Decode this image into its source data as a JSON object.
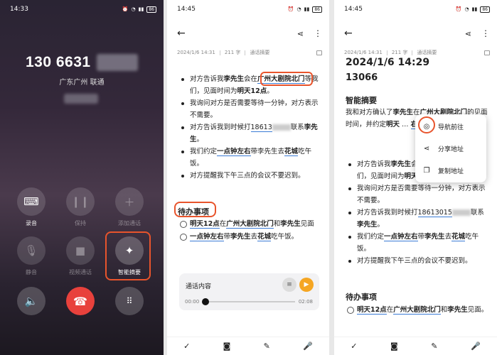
{
  "call": {
    "time": "14:33",
    "battery": "86",
    "number": "130 6631",
    "location": "广东广州 联通",
    "buttons": [
      {
        "label": "录音"
      },
      {
        "label": "保持"
      },
      {
        "label": "添加通话"
      },
      {
        "label": "静音"
      },
      {
        "label": "视频通话"
      },
      {
        "label": "智能摘要"
      }
    ],
    "colors": {
      "accent": "#e8542c",
      "hangup": "#e8413c"
    }
  },
  "note": {
    "time": "14:45",
    "battery": "86",
    "meta_date": "2024/1/6 14:31",
    "meta_words": "211 字",
    "meta_type": "通话摘要",
    "bullets": [
      {
        "parts": [
          {
            "t": "对方告诉我"
          },
          {
            "t": "李先生",
            "b": 1
          },
          {
            "t": "会在"
          },
          {
            "t": "广州大剧院北门",
            "b": 1,
            "u": 1
          },
          {
            "t": "等我们，见面时间为"
          },
          {
            "t": "明天12点",
            "b": 1
          },
          {
            "t": "。"
          }
        ]
      },
      {
        "parts": [
          {
            "t": "我询问对方是否需要等待一分钟，对方表示不需要。"
          }
        ]
      },
      {
        "parts": [
          {
            "t": "对方告诉我到时候打"
          },
          {
            "t": "18613",
            "u": 1
          },
          {
            "blur": 1
          },
          {
            "t": "联系"
          },
          {
            "t": "李先生",
            "b": 1
          },
          {
            "t": "。"
          }
        ]
      },
      {
        "parts": [
          {
            "t": "我们约定"
          },
          {
            "t": "一点钟左右",
            "b": 1,
            "u": 1
          },
          {
            "t": "带李先生去"
          },
          {
            "t": "花城",
            "b": 1,
            "u": 1
          },
          {
            "t": "吃午饭。"
          }
        ]
      },
      {
        "parts": [
          {
            "t": "对方提醒我下午三点的会议不要迟到。"
          }
        ]
      }
    ],
    "todo_title": "待办事项",
    "todos": [
      {
        "parts": [
          {
            "t": "明天12点",
            "b": 1,
            "u": 1
          },
          {
            "t": "在"
          },
          {
            "t": "广州大剧院北门",
            "b": 1,
            "u": 1
          },
          {
            "t": "和"
          },
          {
            "t": "李先生",
            "b": 1
          },
          {
            "t": "见面"
          }
        ]
      },
      {
        "parts": [
          {
            "t": "一点钟左右",
            "b": 1,
            "u": 1
          },
          {
            "t": "带"
          },
          {
            "t": "李先生",
            "b": 1
          },
          {
            "t": "去"
          },
          {
            "t": "花城",
            "b": 1,
            "u": 1
          },
          {
            "t": "吃午饭。"
          }
        ]
      }
    ],
    "audio_title": "通话内容",
    "audio_start": "00:00",
    "audio_end": "02:08"
  },
  "detail": {
    "time": "14:45",
    "battery": "86",
    "meta_date": "2024/1/6 14:31",
    "meta_words": "211 字",
    "meta_type": "通话摘要",
    "title": "2024/1/6 14:29",
    "phone": "13066",
    "summary_title": "智能摘要",
    "summary_parts": [
      {
        "t": "我和对方确认了"
      },
      {
        "t": "李先生",
        "b": 1
      },
      {
        "t": "在"
      },
      {
        "t": "广州大剧院北门",
        "b": 1,
        "u": 1
      },
      {
        "t": "的见面时间，并约定"
      },
      {
        "t": "明天",
        "b": 1
      },
      {
        "t": " … "
      },
      {
        "t": "右",
        "b": 1,
        "u": 1
      },
      {
        "t": "带他去"
      },
      {
        "t": "花城",
        "b": 1,
        "u": 1
      },
      {
        "t": "吃午饭。"
      }
    ],
    "bullets": [
      {
        "parts": [
          {
            "t": "对方告诉我"
          },
          {
            "t": "李先生",
            "b": 1
          },
          {
            "t": "会在"
          },
          {
            "t": "广州大剧院北门",
            "b": 1,
            "u": 1
          },
          {
            "t": "等我们，见面时间为"
          },
          {
            "t": "明天12点",
            "b": 1
          },
          {
            "t": "。"
          }
        ]
      },
      {
        "parts": [
          {
            "t": "我询问对方是否需要等待一分钟，对方表示不需要。"
          }
        ]
      },
      {
        "parts": [
          {
            "t": "对方告诉我到时候打"
          },
          {
            "t": "18613015",
            "u": 1
          },
          {
            "blur": 1
          },
          {
            "t": "联系"
          },
          {
            "t": "李先生",
            "b": 1
          },
          {
            "t": "。"
          }
        ]
      },
      {
        "parts": [
          {
            "t": "我们约定"
          },
          {
            "t": "一点钟左右",
            "b": 1,
            "u": 1
          },
          {
            "t": "带"
          },
          {
            "t": "李先生",
            "b": 1
          },
          {
            "t": "去"
          },
          {
            "t": "花城",
            "b": 1,
            "u": 1
          },
          {
            "t": "吃午饭。"
          }
        ]
      },
      {
        "parts": [
          {
            "t": "对方提醒我下午三点的会议不要迟到。"
          }
        ]
      }
    ],
    "todo_title": "待办事项",
    "todos": [
      {
        "parts": [
          {
            "t": "明天12点",
            "b": 1,
            "u": 1
          },
          {
            "t": "在"
          },
          {
            "t": "广州大剧院北门",
            "b": 1,
            "u": 1
          },
          {
            "t": "和"
          },
          {
            "t": "李先生",
            "b": 1
          },
          {
            "t": "见面。"
          }
        ]
      }
    ],
    "popup": [
      {
        "label": "导航前往",
        "icon": "navigate-icon"
      },
      {
        "label": "分享地址",
        "icon": "share-icon"
      },
      {
        "label": "复制地址",
        "icon": "copy-icon"
      }
    ]
  }
}
